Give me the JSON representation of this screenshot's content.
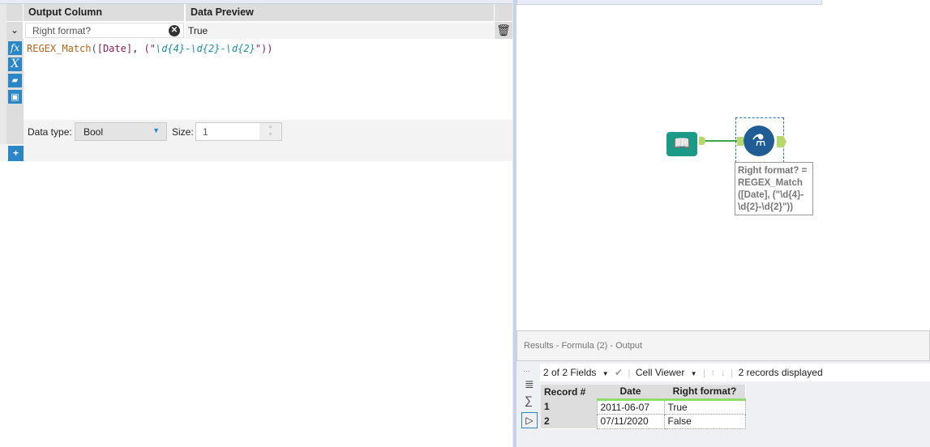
{
  "formula": {
    "headers": {
      "output_column": "Output Column",
      "data_preview": "Data Preview"
    },
    "row": {
      "output_column": "Right format?",
      "preview": "True"
    },
    "expression": {
      "fn": "REGEX_Match",
      "p1": "(",
      "field": "[Date]",
      "comma": ", ",
      "p2": "(\"",
      "regex": "\\d{4}-\\d{2}-\\d{2}",
      "close": "\"))"
    },
    "data_type_label": "Data type:",
    "data_type": "Bool",
    "size_label": "Size:",
    "size": "1",
    "icons": [
      "fx-icon",
      "variable-icon",
      "open-folder-icon",
      "save-icon"
    ],
    "add_label": "+"
  },
  "canvas": {
    "annotation": "Right format? = REGEX_Match ([Date], (\"\\d{4}-\\d{2}-\\d{2}\"))"
  },
  "results": {
    "title": "Results - Formula (2) - Output",
    "fields": "2 of 2 Fields",
    "viewer": "Cell Viewer",
    "status": "2 records displayed",
    "columns": [
      "Record #",
      "Date",
      "Right format?"
    ],
    "rows": [
      [
        "1",
        "2011-06-07",
        "True"
      ],
      [
        "2",
        "07/11/2020",
        "False"
      ]
    ]
  },
  "colors": {
    "accent": "#2a86c6",
    "tool_teal": "#1b9a87",
    "tool_blue": "#1f5d94",
    "connector": "#b8d86b"
  }
}
